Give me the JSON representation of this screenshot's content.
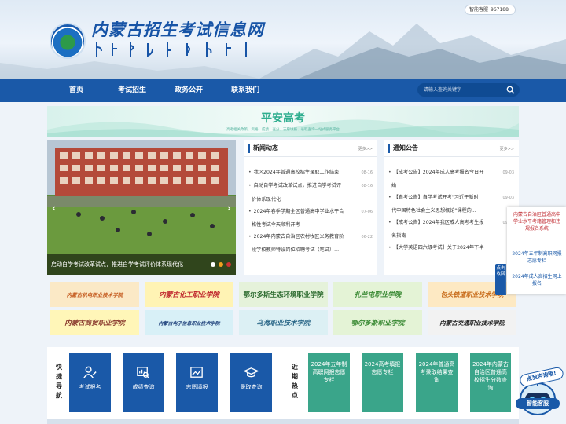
{
  "header": {
    "site_title": "内蒙古招生考试信息网",
    "service_label": "智能客服",
    "service_count": "967188"
  },
  "nav": {
    "items": [
      "首页",
      "考试招生",
      "政务公开",
      "联系我们"
    ],
    "search_placeholder": "请输入查询关键字"
  },
  "banner": {
    "title": "平安高考",
    "subtitle": "高考相关政策、资格、成绩、查分、志愿填报、录取查询一站式服务平台"
  },
  "slider": {
    "caption": "启动自学考试改革试点，推进自学考试评价体系现代化"
  },
  "news": {
    "title": "新闻动态",
    "more": "更多>>",
    "items": [
      {
        "text": "我区2024年普通高校招生录取工作结束",
        "date": "08-16"
      },
      {
        "text": "启动自学考试改革试点，推进自学考试评",
        "cont": "价体系现代化",
        "date": "08-16"
      },
      {
        "text": "2024年春季学期全区普通高中学业水平合",
        "cont": "格性考试今天顺利开考",
        "date": "07-06"
      },
      {
        "text": "2024年内蒙古自治区农村牧区义务教育阶",
        "cont": "段学校教师特设岗位招聘考试（笔试）...",
        "date": "06-22"
      }
    ]
  },
  "notice": {
    "title": "通知公告",
    "more": "更多>>",
    "items": [
      {
        "text": "【成考公告】2024年成人高考报名今日开",
        "cont": "始",
        "date": "09-03"
      },
      {
        "text": "【自考公告】自学考试开考\"习近平新时",
        "cont": "代中国特色社会主义思想概论\"课程的...",
        "date": "09-03"
      },
      {
        "text": "【成考公告】2024年我区成人高考考生报",
        "cont": "名指南",
        "date": "09-03"
      },
      {
        "text": "【大学英语四六级考试】关于2024年下半",
        "cont": "",
        "date": ""
      }
    ]
  },
  "schools": {
    "row1": [
      "内蒙古机电职业技术学院",
      "内蒙古化工职业学院",
      "鄂尔多斯生态环境职业学院",
      "扎兰屯职业学院",
      "包头铁道职业技术学院"
    ],
    "row2": [
      "内蒙古商贸职业学院",
      "内蒙古电子信息职业技术学院",
      "乌海职业技术学院",
      "鄂尔多斯职业学院",
      "内蒙古交通职业技术学院"
    ]
  },
  "float": {
    "items": [
      "内蒙古自治区普通高中学业水平考籍管理和违规报名系统",
      "2024年五年制高职网报志愿专栏",
      "2024年成人高招生网上报名"
    ],
    "side_tab": "点击收回"
  },
  "quick": {
    "label": "快捷导航",
    "buttons": [
      "考试报名",
      "成绩查询",
      "志愿填报",
      "录取查询"
    ],
    "hot_label": "近期热点",
    "hot_items": [
      "2024年五年制高职网报志愿专栏",
      "2024高考填报志愿专栏",
      "2024年普通高考录取结果查询",
      "2024年内蒙古自治区普通高校招生分数查询"
    ]
  },
  "robot": {
    "bubble": "点我咨询哦!",
    "label": "智能客服"
  },
  "colors": {
    "nav": "#1a59a8",
    "banner_green": "#2fae8f",
    "hot_green": "#3aa58a",
    "float_red": "#c0282e"
  }
}
